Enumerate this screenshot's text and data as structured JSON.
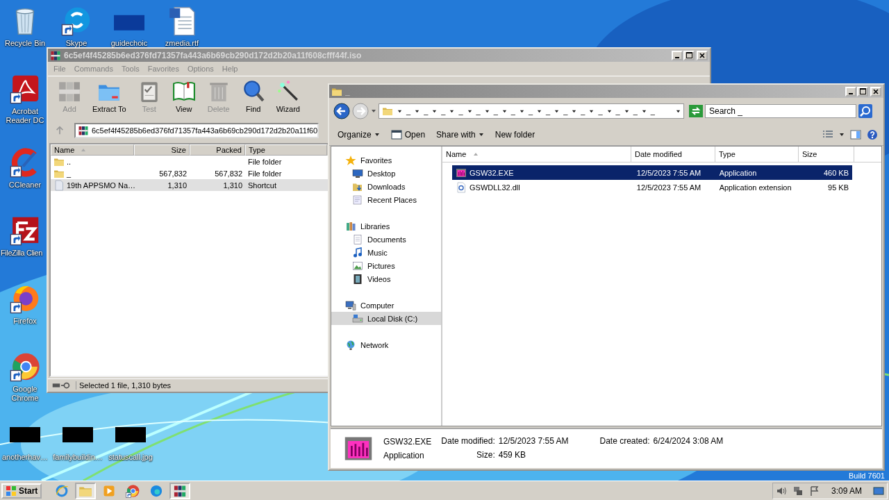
{
  "desktop": {
    "column": [
      {
        "label": "Recycle Bin",
        "kind": "recycle"
      },
      {
        "label": "Acrobat Reader DC",
        "kind": "acrobat"
      },
      {
        "label": "CCleaner",
        "kind": "ccleaner"
      },
      {
        "label": "FileZilla Clien",
        "kind": "filezilla"
      },
      {
        "label": "Firefox",
        "kind": "firefox"
      },
      {
        "label": "Google Chrome",
        "kind": "chrome"
      }
    ],
    "top_row": [
      {
        "label": "Skype",
        "kind": "skype"
      },
      {
        "label": "guidechoic",
        "kind": "darkthumb"
      },
      {
        "label": "zmedia.rtf",
        "kind": "word"
      }
    ],
    "bottom_row": [
      {
        "label": "anotherhav…",
        "kind": "thumb"
      },
      {
        "label": "familybuildin…",
        "kind": "thumb"
      },
      {
        "label": "statuscall.jpg",
        "kind": "thumb"
      }
    ],
    "build": "Build 7601"
  },
  "winrar": {
    "title": "6c5ef4f45285b6ed376fd71357fa443a6b69cb290d172d2b20a11f608cfff44f.iso",
    "menu": [
      "File",
      "Commands",
      "Tools",
      "Favorites",
      "Options",
      "Help"
    ],
    "toolbar": [
      {
        "label": "Add",
        "kind": "add",
        "disabled": true
      },
      {
        "label": "Extract To",
        "kind": "extract",
        "disabled": false
      },
      {
        "label": "Test",
        "kind": "test",
        "disabled": true
      },
      {
        "label": "View",
        "kind": "view",
        "disabled": false
      },
      {
        "label": "Delete",
        "kind": "delete",
        "disabled": true
      },
      {
        "label": "Find",
        "kind": "find",
        "disabled": false
      },
      {
        "label": "Wizard",
        "kind": "wizard",
        "disabled": false
      }
    ],
    "address": "6c5ef4f45285b6ed376fd71357fa443a6b69cb290d172d2b20a11f60",
    "columns": [
      "Name",
      "Size",
      "Packed",
      "Type"
    ],
    "rows": [
      {
        "name": "..",
        "kind": "folder",
        "type": "File folder",
        "selected": false
      },
      {
        "name": "_",
        "kind": "folder",
        "size": "567,832",
        "packed": "567,832",
        "type": "File folder",
        "selected": false
      },
      {
        "name": "19th APPSMO Na…",
        "kind": "shortcut",
        "size": "1,310",
        "packed": "1,310",
        "type": "Shortcut",
        "selected": true
      }
    ],
    "status": "Selected 1 file, 1,310 bytes"
  },
  "explorer": {
    "title": "_",
    "breadcrumb": [
      "_",
      "_",
      "_",
      "_",
      "_",
      "_",
      "_",
      "_",
      "_",
      "_",
      "_",
      "_",
      "_",
      "_",
      "_"
    ],
    "search": {
      "placeholder": "Search _"
    },
    "commands": [
      {
        "label": "Organize",
        "kind": "menu"
      },
      {
        "label": "Open",
        "kind": "open"
      },
      {
        "label": "Share with",
        "kind": "menu"
      },
      {
        "label": "New folder",
        "kind": "plain"
      }
    ],
    "nav": [
      {
        "label": "Favorites",
        "kind": "star",
        "selected": false,
        "children": [
          {
            "label": "Desktop",
            "kind": "desktop",
            "selected": false
          },
          {
            "label": "Downloads",
            "kind": "downloads",
            "selected": false
          },
          {
            "label": "Recent Places",
            "kind": "recent",
            "selected": false
          }
        ]
      },
      {
        "label": "Libraries",
        "kind": "library",
        "selected": false,
        "children": [
          {
            "label": "Documents",
            "kind": "documents",
            "selected": false
          },
          {
            "label": "Music",
            "kind": "music",
            "selected": false
          },
          {
            "label": "Pictures",
            "kind": "pictures",
            "selected": false
          },
          {
            "label": "Videos",
            "kind": "videos",
            "selected": false
          }
        ]
      },
      {
        "label": "Computer",
        "kind": "computer",
        "selected": false,
        "children": [
          {
            "label": "Local Disk (C:)",
            "kind": "drive",
            "selected": true
          }
        ]
      },
      {
        "label": "Network",
        "kind": "network",
        "selected": false
      }
    ],
    "columns": [
      "Name",
      "Date modified",
      "Type",
      "Size"
    ],
    "rows": [
      {
        "name": "GSW32.EXE",
        "kind": "app",
        "date": "12/5/2023 7:55 AM",
        "type": "Application",
        "size": "460 KB",
        "selected": true
      },
      {
        "name": "GSWDLL32.dll",
        "kind": "dll",
        "date": "12/5/2023 7:55 AM",
        "type": "Application extension",
        "size": "95 KB",
        "selected": false
      }
    ],
    "details": {
      "name": "GSW32.EXE",
      "type": "Application",
      "fields": [
        {
          "label": "Date modified:",
          "value": "12/5/2023 7:55 AM"
        },
        {
          "label": "Size:",
          "value": "459 KB"
        },
        {
          "label": "Date created:",
          "value": "6/24/2024 3:08 AM"
        }
      ]
    }
  },
  "taskbar": {
    "start": "Start",
    "apps": [
      {
        "kind": "ie",
        "active": false
      },
      {
        "kind": "folder",
        "active": true
      },
      {
        "kind": "media",
        "active": false
      },
      {
        "kind": "chrome",
        "active": false
      },
      {
        "kind": "edge",
        "active": false
      },
      {
        "kind": "winrar",
        "active": true
      }
    ],
    "clock": "3:09 AM"
  }
}
